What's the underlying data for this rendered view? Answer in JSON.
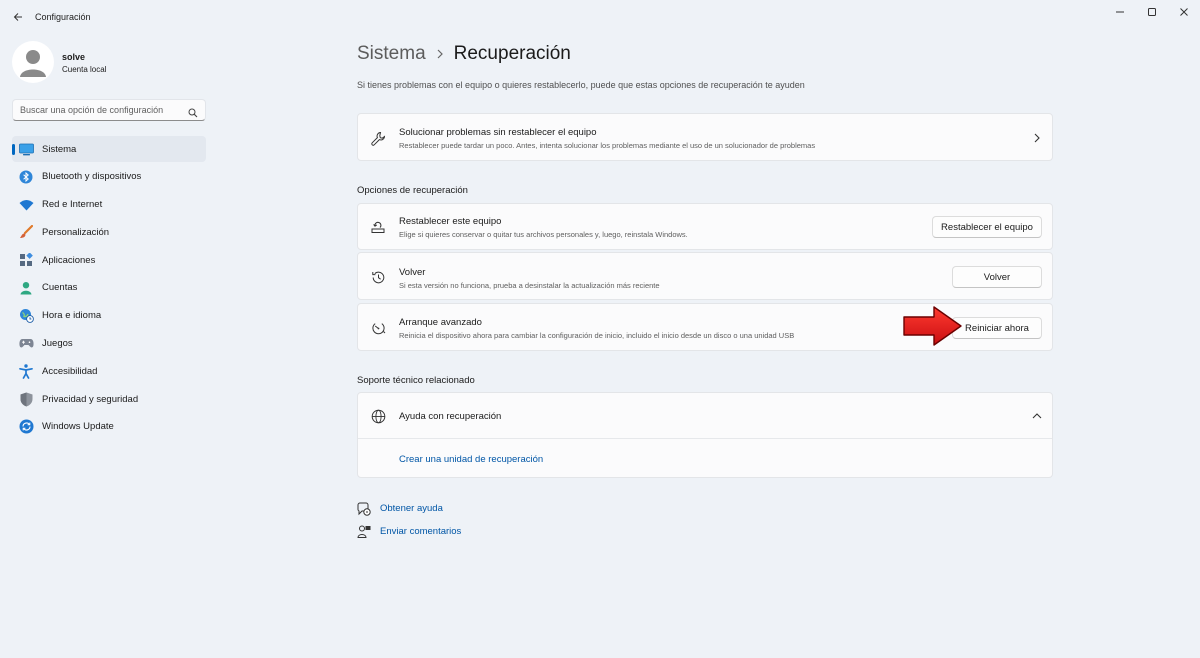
{
  "window": {
    "title": "Configuración",
    "controls": [
      "minimize-icon",
      "maximize-icon",
      "close-icon"
    ]
  },
  "profile": {
    "name": "solve",
    "account_type": "Cuenta local"
  },
  "search": {
    "placeholder": "Buscar una opción de configuración"
  },
  "sidebar": {
    "items": [
      {
        "label": "Sistema",
        "icon": "system-icon",
        "active": true
      },
      {
        "label": "Bluetooth y dispositivos",
        "icon": "bluetooth-icon"
      },
      {
        "label": "Red e Internet",
        "icon": "wifi-icon"
      },
      {
        "label": "Personalización",
        "icon": "brush-icon"
      },
      {
        "label": "Aplicaciones",
        "icon": "apps-icon"
      },
      {
        "label": "Cuentas",
        "icon": "accounts-icon"
      },
      {
        "label": "Hora e idioma",
        "icon": "globe-clock-icon"
      },
      {
        "label": "Juegos",
        "icon": "gamepad-icon"
      },
      {
        "label": "Accesibilidad",
        "icon": "accessibility-icon"
      },
      {
        "label": "Privacidad y seguridad",
        "icon": "shield-icon"
      },
      {
        "label": "Windows Update",
        "icon": "update-icon"
      }
    ]
  },
  "main": {
    "breadcrumb": {
      "parent": "Sistema",
      "current": "Recuperación"
    },
    "description": "Si tienes problemas con el equipo o quieres restablecerlo, puede que estas opciones de recuperación te ayuden",
    "troubleshoot": {
      "title": "Solucionar problemas sin restablecer el equipo",
      "subtitle": "Restablecer puede tardar un poco. Antes, intenta solucionar los problemas mediante el uso de un solucionador de problemas"
    },
    "recovery_header": "Opciones de recuperación",
    "recovery_options": [
      {
        "title": "Restablecer este equipo",
        "subtitle": "Elige si quieres conservar o quitar tus archivos personales y, luego, reinstala Windows.",
        "button": "Restablecer el equipo",
        "icon": "reset-pc-icon"
      },
      {
        "title": "Volver",
        "subtitle": "Si esta versión no funciona, prueba a desinstalar la actualización más reciente",
        "button": "Volver",
        "icon": "history-icon"
      },
      {
        "title": "Arranque avanzado",
        "subtitle": "Reinicia el dispositivo ahora para cambiar la configuración de inicio, incluido el inicio desde un disco o una unidad USB",
        "button": "Reiniciar ahora",
        "icon": "advanced-startup-icon"
      }
    ],
    "support_header": "Soporte técnico relacionado",
    "support": {
      "title": "Ayuda con recuperación",
      "link": "Crear una unidad de recuperación"
    },
    "help_links": [
      {
        "label": "Obtener ayuda",
        "icon": "get-help-icon"
      },
      {
        "label": "Enviar comentarios",
        "icon": "feedback-icon"
      }
    ]
  },
  "annotation": {
    "arrow_color": "#e8141b"
  },
  "colors": {
    "accent": "#0067c0",
    "link": "#0056a6",
    "background": "#eef2f7",
    "card": "#fbfbfc"
  }
}
